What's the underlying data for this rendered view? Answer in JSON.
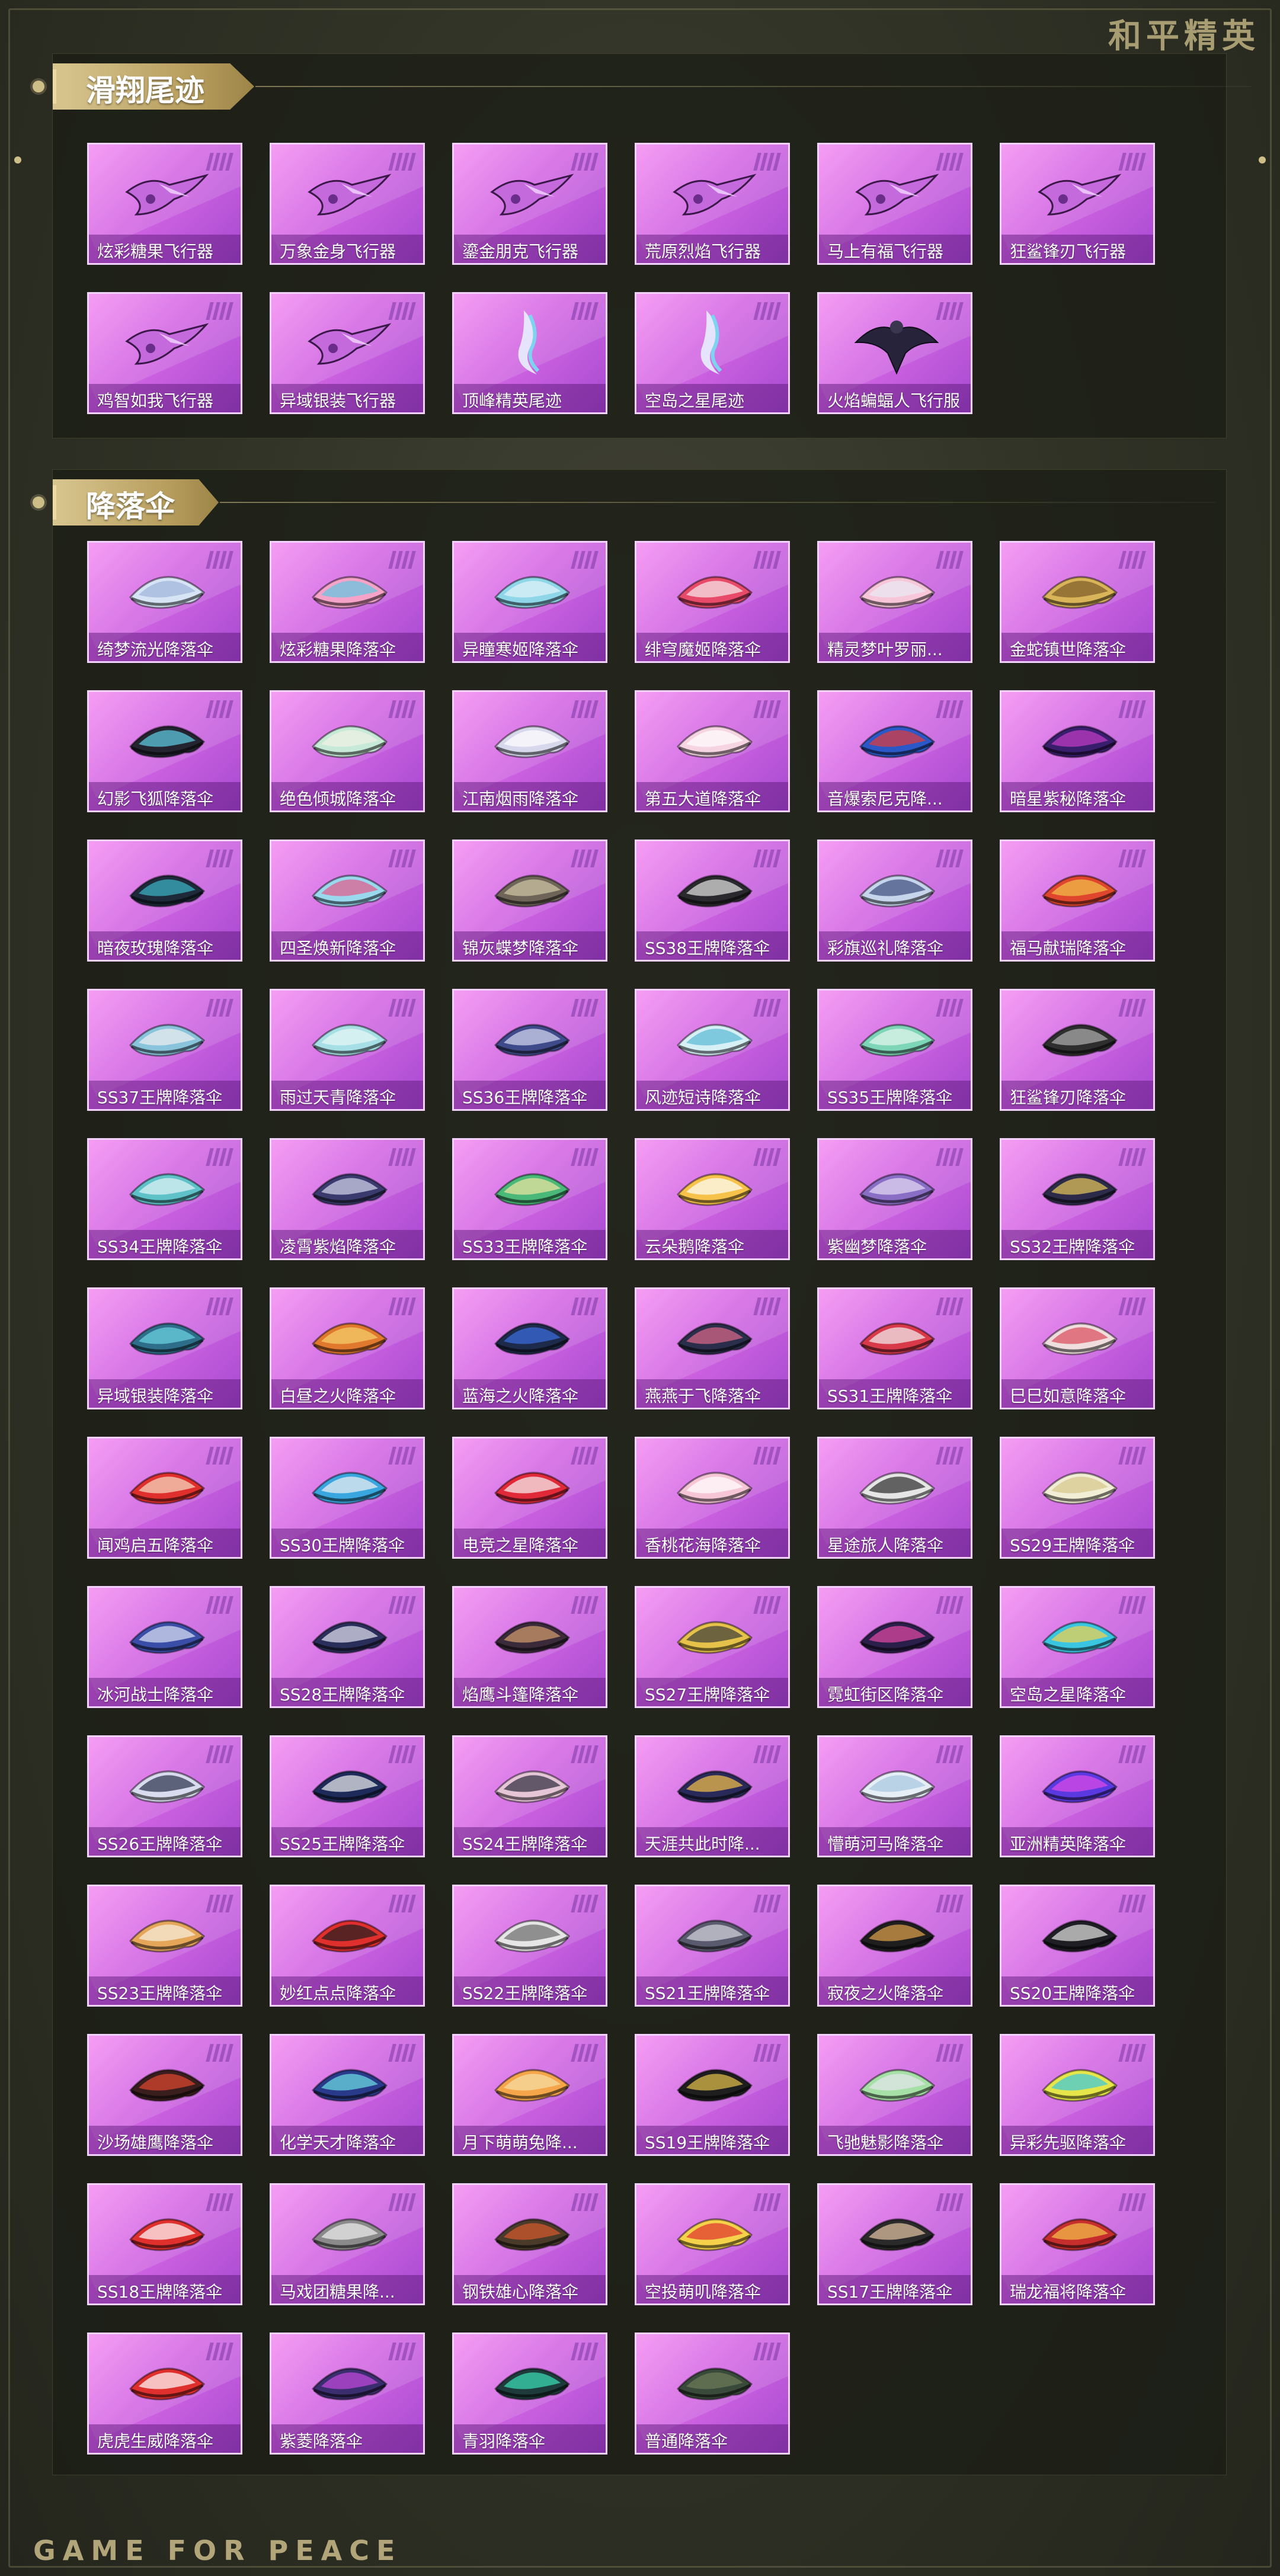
{
  "brand": "和平精英",
  "footer": "GAME FOR PEACE",
  "sections": [
    {
      "title": "滑翔尾迹",
      "items": [
        {
          "name": "炫彩糖果飞行器",
          "icon": "glider-icon"
        },
        {
          "name": "万象金身飞行器",
          "icon": "glider-icon"
        },
        {
          "name": "鎏金朋克飞行器",
          "icon": "glider-icon"
        },
        {
          "name": "荒原烈焰飞行器",
          "icon": "glider-icon"
        },
        {
          "name": "马上有福飞行器",
          "icon": "glider-icon"
        },
        {
          "name": "狂鲨锋刃飞行器",
          "icon": "glider-icon"
        },
        {
          "name": "鸡智如我飞行器",
          "icon": "glider-icon"
        },
        {
          "name": "异域银装飞行器",
          "icon": "glider-icon"
        },
        {
          "name": "顶峰精英尾迹",
          "icon": "trail-icon"
        },
        {
          "name": "空岛之星尾迹",
          "icon": "trail-icon"
        },
        {
          "name": "火焰蝙蝠人飞行服",
          "icon": "wingsuit-icon"
        }
      ]
    },
    {
      "title": "降落伞",
      "items": [
        {
          "name": "绮梦流光降落伞",
          "icon": "parachute-icon",
          "colors": [
            "#d6e4f6",
            "#9fb4d8"
          ]
        },
        {
          "name": "炫彩糖果降落伞",
          "icon": "parachute-icon",
          "colors": [
            "#f5a3c8",
            "#5fc6e0"
          ]
        },
        {
          "name": "异瞳寒姬降落伞",
          "icon": "parachute-icon",
          "colors": [
            "#8ed6e8",
            "#e4f4fa"
          ]
        },
        {
          "name": "绯穹魔姬降落伞",
          "icon": "parachute-icon",
          "colors": [
            "#e84a6a",
            "#f7eef0"
          ]
        },
        {
          "name": "精灵梦叶罗丽...",
          "icon": "parachute-icon",
          "colors": [
            "#f7c6d9",
            "#e9e9f4"
          ]
        },
        {
          "name": "金蛇镇世降落伞",
          "icon": "parachute-icon",
          "colors": [
            "#d9b458",
            "#7a5a28"
          ]
        },
        {
          "name": "幻影飞狐降落伞",
          "icon": "parachute-icon",
          "colors": [
            "#242430",
            "#5fd0e6"
          ]
        },
        {
          "name": "绝色倾城降落伞",
          "icon": "parachute-icon",
          "colors": [
            "#c7ead8",
            "#f1f1e6"
          ]
        },
        {
          "name": "江南烟雨降落伞",
          "icon": "parachute-icon",
          "colors": [
            "#d8d8ec",
            "#ffffff"
          ]
        },
        {
          "name": "第五大道降落伞",
          "icon": "parachute-icon",
          "colors": [
            "#f6d4e2",
            "#ffffff"
          ]
        },
        {
          "name": "音爆索尼克降...",
          "icon": "parachute-icon",
          "colors": [
            "#2b58c6",
            "#e33a3a"
          ]
        },
        {
          "name": "暗星紫秘降落伞",
          "icon": "parachute-icon",
          "colors": [
            "#3a1e6e",
            "#c43cc8"
          ]
        },
        {
          "name": "暗夜玫瑰降落伞",
          "icon": "parachute-icon",
          "colors": [
            "#1e2a3a",
            "#3ab6c8"
          ]
        },
        {
          "name": "四圣焕新降落伞",
          "icon": "parachute-icon",
          "colors": [
            "#9ad8ee",
            "#e35a8a"
          ]
        },
        {
          "name": "锦灰蝶梦降落伞",
          "icon": "parachute-icon",
          "colors": [
            "#6e6458",
            "#d2c8a8"
          ]
        },
        {
          "name": "SS38王牌降落伞",
          "icon": "parachute-icon",
          "colors": [
            "#2a2a2e",
            "#e6e6e6"
          ]
        },
        {
          "name": "彩旗巡礼降落伞",
          "icon": "parachute-icon",
          "colors": [
            "#c6d4ec",
            "#3a4c7a"
          ]
        },
        {
          "name": "福马献瑞降落伞",
          "icon": "parachute-icon",
          "colors": [
            "#e0462e",
            "#f2c24a"
          ]
        },
        {
          "name": "SS37王牌降落伞",
          "icon": "parachute-icon",
          "colors": [
            "#8ac4dc",
            "#f0f0f0"
          ]
        },
        {
          "name": "雨过天青降落伞",
          "icon": "parachute-icon",
          "colors": [
            "#a6e0e6",
            "#e8f6f4"
          ]
        },
        {
          "name": "SS36王牌降落伞",
          "icon": "parachute-icon",
          "colors": [
            "#3e4a8a",
            "#d8dcf2"
          ]
        },
        {
          "name": "风迹短诗降落伞",
          "icon": "parachute-icon",
          "colors": [
            "#d6f0f6",
            "#5ab8d6"
          ]
        },
        {
          "name": "SS35王牌降落伞",
          "icon": "parachute-icon",
          "colors": [
            "#7ed6b8",
            "#e6f6ee"
          ]
        },
        {
          "name": "狂鲨锋刃降落伞",
          "icon": "parachute-icon",
          "colors": [
            "#2e2e2e",
            "#b0b0b0"
          ]
        },
        {
          "name": "SS34王牌降落伞",
          "icon": "parachute-icon",
          "colors": [
            "#5ec2c8",
            "#e2f4f6"
          ]
        },
        {
          "name": "凌霄紫焰降落伞",
          "icon": "parachute-icon",
          "colors": [
            "#3a3a6e",
            "#d6d6ee"
          ]
        },
        {
          "name": "SS33王牌降落伞",
          "icon": "parachute-icon",
          "colors": [
            "#4ab878",
            "#f2e6a2"
          ]
        },
        {
          "name": "云朵鹅降落伞",
          "icon": "parachute-icon",
          "colors": [
            "#f6c24a",
            "#ffffff"
          ]
        },
        {
          "name": "紫幽梦降落伞",
          "icon": "parachute-icon",
          "colors": [
            "#8a6ec6",
            "#e6dcf4"
          ]
        },
        {
          "name": "SS32王牌降落伞",
          "icon": "parachute-icon",
          "colors": [
            "#2c2c4a",
            "#e8c85a"
          ]
        },
        {
          "name": "异域银装降落伞",
          "icon": "parachute-icon",
          "colors": [
            "#2e6e8a",
            "#6ed6e6"
          ]
        },
        {
          "name": "白昼之火降落伞",
          "icon": "parachute-icon",
          "colors": [
            "#e0782e",
            "#f6d26e"
          ]
        },
        {
          "name": "蓝海之火降落伞",
          "icon": "parachute-icon",
          "colors": [
            "#1e2a4a",
            "#3a6ee0"
          ]
        },
        {
          "name": "燕燕于飞降落伞",
          "icon": "parachute-icon",
          "colors": [
            "#2a2e4a",
            "#e06a8a"
          ]
        },
        {
          "name": "SS31王牌降落伞",
          "icon": "parachute-icon",
          "colors": [
            "#d83a4a",
            "#f2f2f2"
          ]
        },
        {
          "name": "巳巳如意降落伞",
          "icon": "parachute-icon",
          "colors": [
            "#f0dede",
            "#d84a5a"
          ]
        },
        {
          "name": "闻鸡启五降落伞",
          "icon": "parachute-icon",
          "colors": [
            "#e0302e",
            "#f6e0c6"
          ]
        },
        {
          "name": "SS30王牌降落伞",
          "icon": "parachute-icon",
          "colors": [
            "#3aa6e0",
            "#f2f2f2"
          ]
        },
        {
          "name": "电竞之星降落伞",
          "icon": "parachute-icon",
          "colors": [
            "#e02a3a",
            "#f6f6f6"
          ]
        },
        {
          "name": "香桃花海降落伞",
          "icon": "parachute-icon",
          "colors": [
            "#f6c6d6",
            "#ffffff"
          ]
        },
        {
          "name": "星途旅人降落伞",
          "icon": "parachute-icon",
          "colors": [
            "#e6e6e6",
            "#2a2a2a"
          ]
        },
        {
          "name": "SS29王牌降落伞",
          "icon": "parachute-icon",
          "colors": [
            "#f2eed6",
            "#d6c68a"
          ]
        },
        {
          "name": "冰河战士降落伞",
          "icon": "parachute-icon",
          "colors": [
            "#3a4ea8",
            "#dfe6f6"
          ]
        },
        {
          "name": "SS28王牌降落伞",
          "icon": "parachute-icon",
          "colors": [
            "#2a2e5a",
            "#e6e6f2"
          ]
        },
        {
          "name": "焰鹰斗篷降落伞",
          "icon": "parachute-icon",
          "colors": [
            "#3a2a3a",
            "#d6a06e"
          ]
        },
        {
          "name": "SS27王牌降落伞",
          "icon": "parachute-icon",
          "colors": [
            "#e6c24a",
            "#3a3a3a"
          ]
        },
        {
          "name": "霓虹街区降落伞",
          "icon": "parachute-icon",
          "colors": [
            "#2a1e4a",
            "#e64aa6"
          ]
        },
        {
          "name": "空岛之星降落伞",
          "icon": "parachute-icon",
          "colors": [
            "#3ac6e0",
            "#f6d24a"
          ]
        },
        {
          "name": "SS26王牌降落伞",
          "icon": "parachute-icon",
          "colors": [
            "#d8dcee",
            "#2a2e4a"
          ]
        },
        {
          "name": "SS25王牌降落伞",
          "icon": "parachute-icon",
          "colors": [
            "#1e2a5a",
            "#f0f0f0"
          ]
        },
        {
          "name": "SS24王牌降落伞",
          "icon": "parachute-icon",
          "colors": [
            "#e6c6d6",
            "#2a2a3a"
          ]
        },
        {
          "name": "天涯共此时降...",
          "icon": "parachute-icon",
          "colors": [
            "#2a2a5a",
            "#f6c24a"
          ]
        },
        {
          "name": "懵萌河马降落伞",
          "icon": "parachute-icon",
          "colors": [
            "#e6eef6",
            "#a6c6e0"
          ]
        },
        {
          "name": "亚洲精英降落伞",
          "icon": "parachute-icon",
          "colors": [
            "#5a3ae0",
            "#e04ae6"
          ]
        },
        {
          "name": "SS23王牌降落伞",
          "icon": "parachute-icon",
          "colors": [
            "#e6a65a",
            "#f6f0e0"
          ]
        },
        {
          "name": "妙红点点降落伞",
          "icon": "parachute-icon",
          "colors": [
            "#e0302e",
            "#1e1e1e"
          ]
        },
        {
          "name": "SS22王牌降落伞",
          "icon": "parachute-icon",
          "colors": [
            "#e6e6e6",
            "#6a6a6a"
          ]
        },
        {
          "name": "SS21王牌降落伞",
          "icon": "parachute-icon",
          "colors": [
            "#5a5a6e",
            "#d6d6e0"
          ]
        },
        {
          "name": "寂夜之火降落伞",
          "icon": "parachute-icon",
          "colors": [
            "#1e1e1e",
            "#e0a24a"
          ]
        },
        {
          "name": "SS20王牌降落伞",
          "icon": "parachute-icon",
          "colors": [
            "#1e1e24",
            "#e6e6e6"
          ]
        },
        {
          "name": "沙场雄鹰降落伞",
          "icon": "parachute-icon",
          "colors": [
            "#3a1e1e",
            "#e0462e"
          ]
        },
        {
          "name": "化学天才降落伞",
          "icon": "parachute-icon",
          "colors": [
            "#2a3a8a",
            "#6ee0e6"
          ]
        },
        {
          "name": "月下萌萌兔降...",
          "icon": "parachute-icon",
          "colors": [
            "#f6a64a",
            "#f6e0a6"
          ]
        },
        {
          "name": "SS19王牌降落伞",
          "icon": "parachute-icon",
          "colors": [
            "#1e1e1e",
            "#e6c24a"
          ]
        },
        {
          "name": "飞驰魅影降落伞",
          "icon": "parachute-icon",
          "colors": [
            "#a6e0a6",
            "#e6e6ee"
          ]
        },
        {
          "name": "异彩先驱降落伞",
          "icon": "parachute-icon",
          "colors": [
            "#e6e64a",
            "#3ac6e0"
          ]
        },
        {
          "name": "SS18王牌降落伞",
          "icon": "parachute-icon",
          "colors": [
            "#e0302e",
            "#ffffff"
          ]
        },
        {
          "name": "马戏团糖果降...",
          "icon": "parachute-icon",
          "colors": [
            "#8a8a8a",
            "#f0f0f0"
          ]
        },
        {
          "name": "钢铁雄心降落伞",
          "icon": "parachute-icon",
          "colors": [
            "#4a3a2a",
            "#d65a2e"
          ]
        },
        {
          "name": "空投萌叽降落伞",
          "icon": "parachute-icon",
          "colors": [
            "#f6d24a",
            "#e0302e"
          ]
        },
        {
          "name": "SS17王牌降落伞",
          "icon": "parachute-icon",
          "colors": [
            "#2a2a2a",
            "#e6c6a6"
          ]
        },
        {
          "name": "瑞龙福将降落伞",
          "icon": "parachute-icon",
          "colors": [
            "#c62e2e",
            "#f6c24a"
          ]
        },
        {
          "name": "虎虎生威降落伞",
          "icon": "parachute-icon",
          "colors": [
            "#e0302e",
            "#ffffff"
          ]
        },
        {
          "name": "紫菱降落伞",
          "icon": "parachute-icon",
          "colors": [
            "#3a2e6e",
            "#c64ae0"
          ]
        },
        {
          "name": "青羽降落伞",
          "icon": "parachute-icon",
          "colors": [
            "#1e3a3a",
            "#3ae0b8"
          ]
        },
        {
          "name": "普通降落伞",
          "icon": "parachute-icon",
          "colors": [
            "#3a4a3a",
            "#6e7a5a"
          ]
        }
      ]
    }
  ]
}
